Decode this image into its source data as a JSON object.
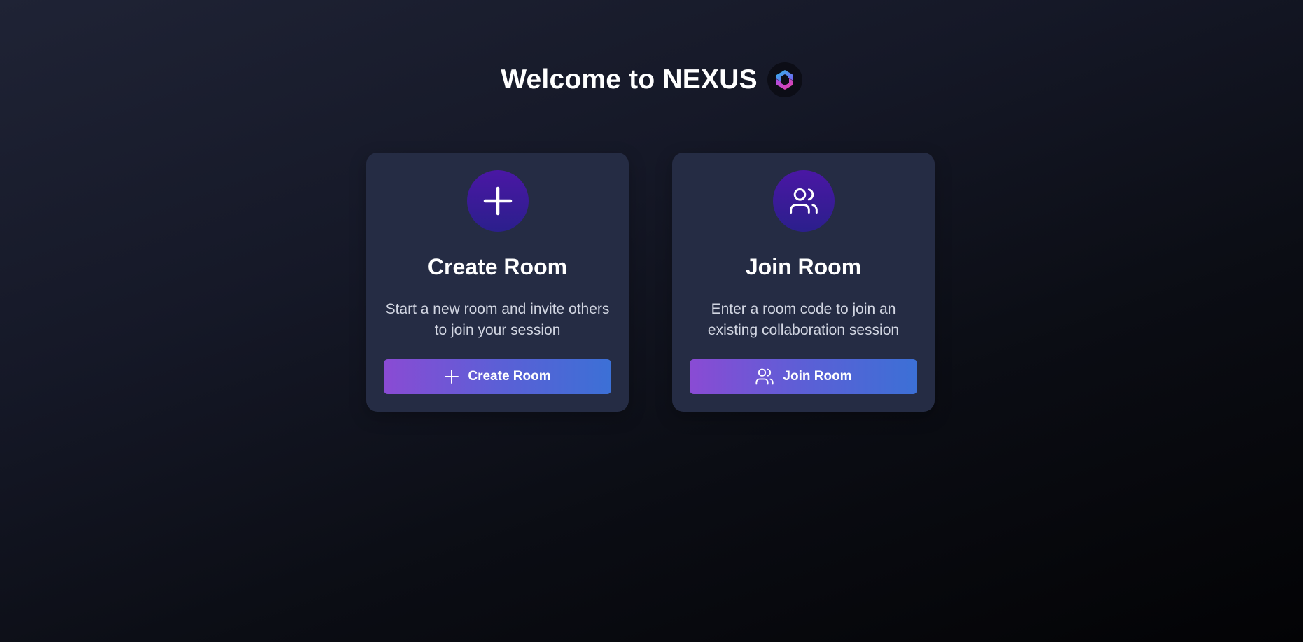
{
  "header": {
    "title": "Welcome to NEXUS",
    "logo_icon": "nexus-logo-icon"
  },
  "cards": [
    {
      "icon": "plus-icon",
      "title": "Create Room",
      "description": "Start a new room and invite others to join your session",
      "button_label": "Create Room",
      "button_icon": "plus-icon"
    },
    {
      "icon": "users-icon",
      "title": "Join Room",
      "description": "Enter a room code to join an existing collaboration session",
      "button_label": "Join Room",
      "button_icon": "users-icon"
    }
  ],
  "colors": {
    "card_background": "#252c44",
    "icon_circle": "#4a17a4",
    "button_gradient_start": "#8a4bd4",
    "button_gradient_end": "#3c70d6",
    "logo_pink": "#e83fa5",
    "logo_blue": "#2fb7ea"
  }
}
